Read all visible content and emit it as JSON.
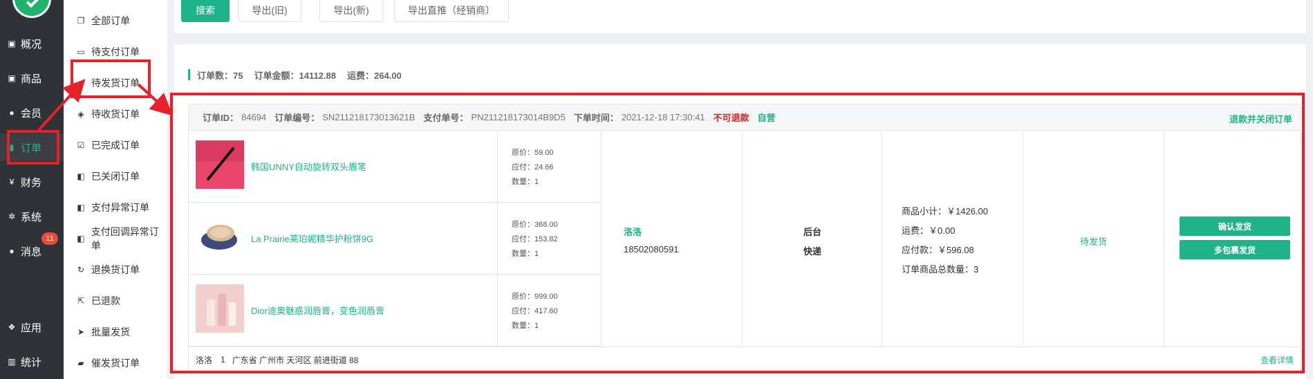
{
  "nav": {
    "items": [
      {
        "label": "概况",
        "icon": "overview-icon"
      },
      {
        "label": "商品",
        "icon": "goods-icon"
      },
      {
        "label": "会员",
        "icon": "members-icon"
      },
      {
        "label": "订单",
        "icon": "order-icon"
      },
      {
        "label": "财务",
        "icon": "finance-icon"
      },
      {
        "label": "系统",
        "icon": "system-icon"
      },
      {
        "label": "消息",
        "icon": "message-icon"
      },
      {
        "label": "应用",
        "icon": "apps-icon"
      },
      {
        "label": "统计",
        "icon": "stats-icon"
      }
    ],
    "message_badge": "11"
  },
  "subnav": {
    "items": [
      {
        "label": "全部订单",
        "icon": "copy-icon"
      },
      {
        "label": "待支付订单",
        "icon": "card-icon"
      },
      {
        "label": "待发货订单",
        "icon": "truck-icon"
      },
      {
        "label": "待收货订单",
        "icon": "dropbox-icon"
      },
      {
        "label": "已完成订单",
        "icon": "check-square-icon"
      },
      {
        "label": "已关闭订单",
        "icon": "cup-icon"
      },
      {
        "label": "支付异常订单",
        "icon": "cup-icon"
      },
      {
        "label": "支付回调异常订单",
        "icon": "cup-icon"
      },
      {
        "label": "退换货订单",
        "icon": "refresh-icon"
      },
      {
        "label": "已退款",
        "icon": "share-icon"
      },
      {
        "label": "批量发货",
        "icon": "paper-plane-icon"
      },
      {
        "label": "催发货订单",
        "icon": "truck-icon"
      }
    ]
  },
  "toolbar": {
    "search": "搜索",
    "export_old": "导出(旧)",
    "export_new": "导出(新)",
    "export_push": "导出直推（经销商）"
  },
  "summary": {
    "count_label": "订单数：75",
    "amount_label": "订单金额：14112.88",
    "shipping_label": "运费：264.00"
  },
  "order": {
    "id_label": "订单ID：",
    "id": "84694",
    "sn_label": "订单编号：",
    "sn": "SN211218173013621B",
    "pay_label": "支付单号：",
    "pay_sn": "PN211218173014B9D5",
    "time_label": "下单时间：",
    "time": "2021-12-18 17:30:41",
    "no_refund": "不可退款",
    "self_run": "自营",
    "refund_close": "退款并关闭订单",
    "products": [
      {
        "name": "韩国UNNY自动旋转双头眉笔",
        "orig": "原价：59.00",
        "due": "应付：24.66",
        "qty": "数量：1"
      },
      {
        "name": "La Prairie莱珀妮精华护粉饼9G",
        "orig": "原价：368.00",
        "due": "应付：153.82",
        "qty": "数量：1"
      },
      {
        "name": "Dior迪奥魅惑润唇膏，变色润唇膏",
        "orig": "原价：999.00",
        "due": "应付：417.60",
        "qty": "数量：1"
      }
    ],
    "buyer_name": "洛洛",
    "buyer_phone": "18502080591",
    "source": "后台",
    "delivery": "快递",
    "subtotal": "商品小计：￥1426.00",
    "freight": "运费：￥0.00",
    "payable": "应付款：￥596.08",
    "total_qty": "订单商品总数量：3",
    "status": "待发货",
    "confirm_ship": "确认发货",
    "multi_ship": "多包裹发货",
    "footer_name": "洛洛",
    "footer_phone": "1",
    "footer_addr": "广东省 广州市 天河区 前进街道 88",
    "detail_link": "查看详情"
  }
}
